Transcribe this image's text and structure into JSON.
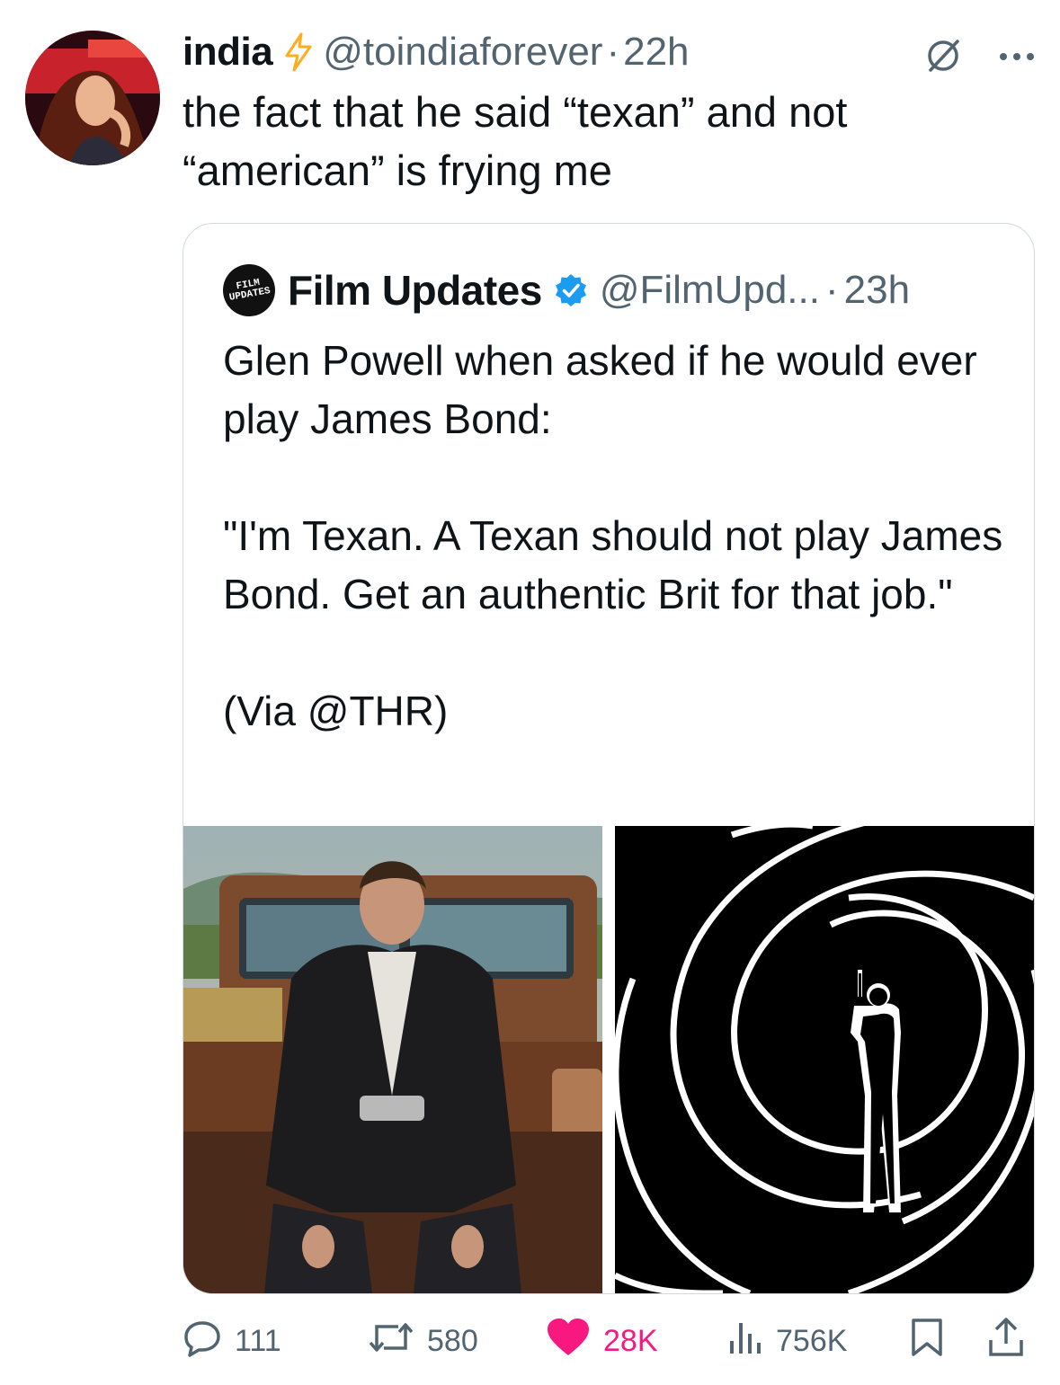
{
  "tweet": {
    "author_name": "india",
    "author_handle": "@toindiaforever",
    "separator": "·",
    "time": "22h",
    "text": "the fact that he said “texan” and not “american” is frying me"
  },
  "quote": {
    "logo_text_line1": "FILM",
    "logo_text_line2": "UPDATES",
    "author_name": "Film Updates",
    "author_handle": "@FilmUpd...",
    "separator": "·",
    "time": "23h",
    "text": "Glen Powell when asked if he would ever play James Bond:\n\n\"I'm Texan. A Texan should not play James Bond. Get an authentic Brit for that job.\"\n\n(Via @THR)"
  },
  "actions": {
    "replies": "111",
    "reposts": "580",
    "likes": "28K",
    "views": "756K"
  },
  "colors": {
    "text": "#0f1419",
    "secondary": "#536471",
    "like": "#f91880",
    "verified": "#1d9bf0",
    "bolt": "#ffad1f"
  },
  "icons": [
    "lightning-bolt-icon",
    "no-entry-icon",
    "more-icon",
    "verified-badge-icon",
    "reply-icon",
    "repost-icon",
    "like-icon",
    "views-icon",
    "bookmark-icon",
    "share-icon"
  ]
}
